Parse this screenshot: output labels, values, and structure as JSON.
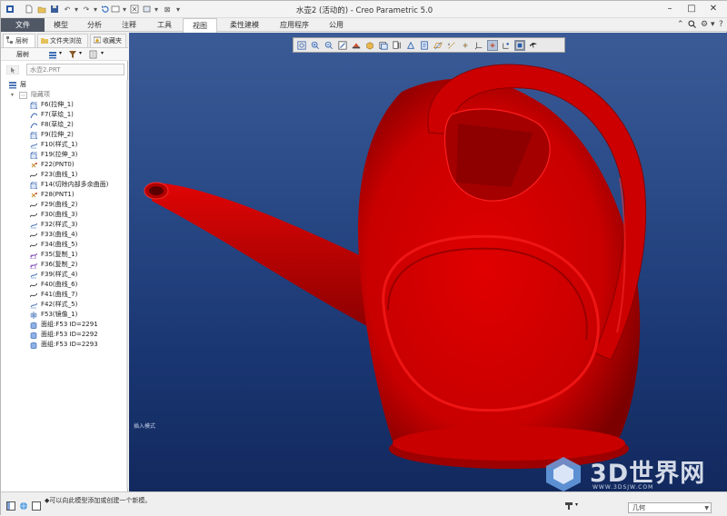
{
  "window": {
    "title": "水壶2 (活动的) - Creo Parametric 5.0"
  },
  "ribbon": {
    "tabs": [
      "文件",
      "模型",
      "分析",
      "注释",
      "工具",
      "视图",
      "柔性建模",
      "应用程序",
      "公用"
    ],
    "active_tab": "视图"
  },
  "navigator": {
    "tabs": [
      "层树",
      "文件夹浏览器",
      "收藏夹"
    ],
    "tree_label": "层树",
    "filter_value": "水壶2.PRT",
    "root_label": "层",
    "group_label": "隐藏项",
    "items": [
      {
        "label": "F6(拉伸_1)",
        "icon": "extrude-icon"
      },
      {
        "label": "F7(草绘_1)",
        "icon": "sketch-icon"
      },
      {
        "label": "F8(草绘_2)",
        "icon": "sketch-icon"
      },
      {
        "label": "F9(拉伸_2)",
        "icon": "extrude-icon"
      },
      {
        "label": "F10(样式_1)",
        "icon": "style-icon"
      },
      {
        "label": "F19(拉伸_3)",
        "icon": "extrude-icon"
      },
      {
        "label": "F22(PNT0)",
        "icon": "datum-point-icon"
      },
      {
        "label": "F23(曲线_1)",
        "icon": "curve-icon"
      },
      {
        "label": "F14(切除内部多余曲面)",
        "icon": "extrude-icon"
      },
      {
        "label": "F28(PNT1)",
        "icon": "datum-point-icon"
      },
      {
        "label": "F29(曲线_2)",
        "icon": "curve-icon"
      },
      {
        "label": "F30(曲线_3)",
        "icon": "curve-icon"
      },
      {
        "label": "F32(样式_3)",
        "icon": "style-icon"
      },
      {
        "label": "F33(曲线_4)",
        "icon": "curve-icon"
      },
      {
        "label": "F34(曲线_5)",
        "icon": "curve-icon"
      },
      {
        "label": "F35(复制_1)",
        "icon": "copy-icon"
      },
      {
        "label": "F36(复制_2)",
        "icon": "copy-icon"
      },
      {
        "label": "F39(样式_4)",
        "icon": "style-icon"
      },
      {
        "label": "F40(曲线_6)",
        "icon": "curve-icon"
      },
      {
        "label": "F41(曲线_7)",
        "icon": "curve-icon"
      },
      {
        "label": "F42(样式_5)",
        "icon": "style-icon"
      },
      {
        "label": "F53(镜像_1)",
        "icon": "mirror-icon"
      },
      {
        "label": "面组:F53 ID=2291",
        "icon": "quilt-icon"
      },
      {
        "label": "面组:F53 ID=2292",
        "icon": "quilt-icon"
      },
      {
        "label": "面组:F53 ID=2293",
        "icon": "quilt-icon"
      }
    ]
  },
  "viewport": {
    "model_color": "#c80000",
    "background_top": "#3b5b97",
    "background_bottom": "#12295e",
    "mode_text": "插入模式"
  },
  "watermark": {
    "text": "3D世界网",
    "sub": "WWW.3DSJW.COM"
  },
  "status": {
    "message": "◆可以向此模型添加或创建一个新模。",
    "selection_filter": "几何"
  },
  "colors": {
    "file_tab": "#505866",
    "accent": "#2e6bd1"
  }
}
